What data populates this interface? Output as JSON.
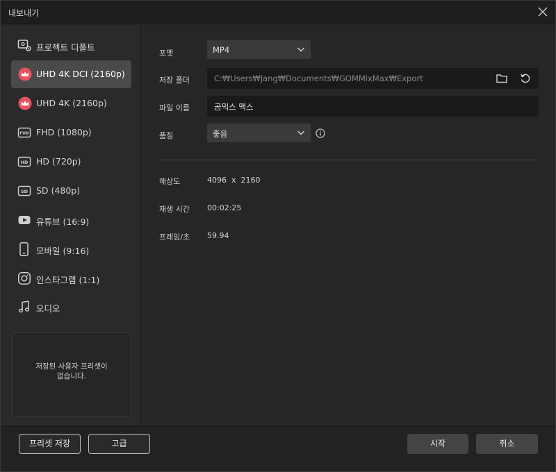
{
  "window": {
    "title": "내보내기"
  },
  "sidebar": {
    "presets": [
      {
        "label": "프로젝트 디폴트",
        "icon": "project-settings-icon"
      },
      {
        "label": "UHD 4K DCI (2160p)",
        "icon": "crown-icon",
        "active": true
      },
      {
        "label": "UHD 4K (2160p)",
        "icon": "crown-icon"
      },
      {
        "label": "FHD (1080p)",
        "icon": "fhd-badge-icon"
      },
      {
        "label": "HD (720p)",
        "icon": "hd-badge-icon"
      },
      {
        "label": "SD (480p)",
        "icon": "sd-badge-icon"
      },
      {
        "label": "유튜브 (16:9)",
        "icon": "youtube-icon"
      },
      {
        "label": "모바일 (9:16)",
        "icon": "mobile-icon"
      },
      {
        "label": "인스타그램 (1:1)",
        "icon": "instagram-icon"
      },
      {
        "label": "오디오",
        "icon": "music-note-icon"
      }
    ],
    "saved_presets_empty": "저장된 사용자 프리셋이\n없습니다."
  },
  "form": {
    "format_label": "포맷",
    "format_value": "MP4",
    "folder_label": "저장 폴더",
    "folder_value": "C:₩Users₩jang₩Documents₩GOMMixMax₩Export",
    "filename_label": "파일 이름",
    "filename_value": "곰믹스 맥스",
    "quality_label": "품질",
    "quality_value": "좋음"
  },
  "meta": {
    "resolution_label": "해상도",
    "resolution_value": "4096  x  2160",
    "duration_label": "재생 시간",
    "duration_value": "00:02:25",
    "fps_label": "프레임/초",
    "fps_value": "59.94"
  },
  "footer": {
    "save_preset": "프리셋 저장",
    "advanced": "고급",
    "start": "시작",
    "cancel": "취소"
  },
  "colors": {
    "crown": "#e8535f",
    "active_bg": "#4a4a4a"
  }
}
